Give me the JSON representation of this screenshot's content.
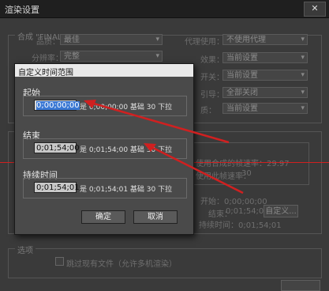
{
  "window": {
    "title": "渲染设置",
    "close_label": "✕",
    "group1_title": "合成 \"FINAL Comp 1920x1080\"",
    "fields_left": [
      {
        "label": "品质：",
        "value": "最佳"
      },
      {
        "label": "分辨率：",
        "value": "完整"
      }
    ],
    "fields_right": [
      {
        "label": "代理使用：",
        "value": "不使用代理"
      },
      {
        "label": "效果：",
        "value": "当前设置"
      },
      {
        "label": "开关：",
        "value": "当前设置"
      },
      {
        "label": "引导：",
        "value": "全部关闭"
      },
      {
        "label": "质：",
        "value": "当前设置"
      }
    ],
    "framerate": {
      "line1": "使用合成的帧速率：29.97",
      "line2": "使用此帧速率：",
      "value": "30"
    },
    "time": {
      "start": "开始：0;00;00;00",
      "end_label": "结束：",
      "end_value": "0;01;54;00",
      "custom_button": "自定义...",
      "duration": "持续时间：0;01;54;01"
    },
    "options_title": "选项",
    "skip_existing": "跳过现有文件（允许多机渲染）"
  },
  "dialog": {
    "title": "自定义时间范围",
    "start": {
      "label": "起始",
      "value": "0;00;00;00",
      "info": "是 0;00;00;00  基础 30 下拉"
    },
    "end": {
      "label": "结束",
      "value": "0;01;54;00",
      "info": "是 0;01;54;00  基础 30 下拉"
    },
    "duration": {
      "label": "持续时间",
      "value": "0;01;54;01",
      "info": "是 0;01;54;01  基础 30 下拉"
    },
    "ok": "确定",
    "cancel": "取消"
  },
  "colors": {
    "annotation_red": "#d02020"
  }
}
